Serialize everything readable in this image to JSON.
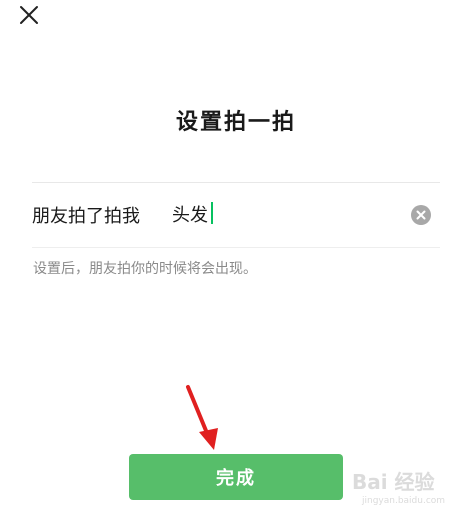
{
  "header": {
    "close_icon": "close-icon"
  },
  "title": "设置拍一拍",
  "pat_field": {
    "prefix": "朋友拍了拍我",
    "value": "头发",
    "placeholder": "",
    "clear_icon": "clear-circle-icon",
    "caret_color": "#07c160"
  },
  "hint": "设置后，朋友拍你的时候将会出现。",
  "annotation": {
    "arrow_color": "#e02020"
  },
  "done_button": {
    "label": "完成",
    "color": "#57be6a"
  },
  "watermark": {
    "brand": "Bai 经验",
    "url": "jingyan.baidu.com"
  }
}
